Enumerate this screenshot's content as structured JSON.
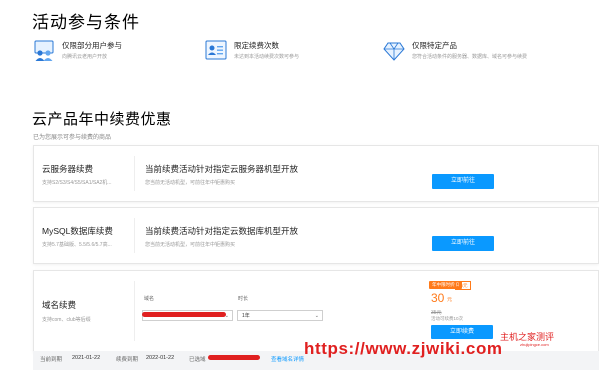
{
  "conditions_section": {
    "title": "活动参与条件",
    "items": [
      {
        "title": "仅限部分用户参与",
        "desc": "向腾讯云老用户开放",
        "icon": "users-icon"
      },
      {
        "title": "限定续费次数",
        "desc": "未达到本活动续费次数可参与",
        "icon": "renew-count-icon"
      },
      {
        "title": "仅限特定产品",
        "desc": "您符合活动条件的服务器、数据库、域名可参与续费",
        "icon": "diamond-icon"
      }
    ]
  },
  "renewal_section": {
    "title": "云产品年中续费优惠",
    "subtitle": "已为您展示可参与续费的商品",
    "products": [
      {
        "name": "云服务器续费",
        "spec": "支持S2/S3/S4/S5/SA1/SA2机...",
        "headline": "当前续费活动针对指定云服务器机型开放",
        "note": "您当前无活动机型，可前往年中钜惠购买",
        "button": "立即前往"
      },
      {
        "name": "MySQL数据库续费",
        "spec": "支持5.7基础版、5.5/5.6/5.7高...",
        "headline": "当前续费活动针对指定云数据库机型开放",
        "note": "您当前无活动机型，可前往年中钜惠购买",
        "button": "立即前往"
      }
    ],
    "domain": {
      "name": "域名续费",
      "spec": "支持com、club等后缀",
      "domain_label": "域名",
      "domain_value": "",
      "duration_label": "时长",
      "duration_value": "1年",
      "badge": "年中限时折扣",
      "badge_count": "25元",
      "price": "30",
      "price_unit": "元",
      "old_price": "35元",
      "saving": "活动可续费10次",
      "button": "立即续费"
    },
    "status_bar": {
      "current_label": "当前到期",
      "current_value": "2021-01-22",
      "after_label": "续费到期",
      "after_value": "2022-01-22",
      "selected_label": "已选域",
      "link": "查看域名详情"
    }
  },
  "watermark": {
    "cn": "主机之家测评",
    "cn_sub": "zhujipingce.com",
    "url": "https://www.zjwiki.com"
  },
  "colors": {
    "accent": "#0a99ff",
    "price": "#ff7a1a",
    "redaction": "#e02020"
  }
}
